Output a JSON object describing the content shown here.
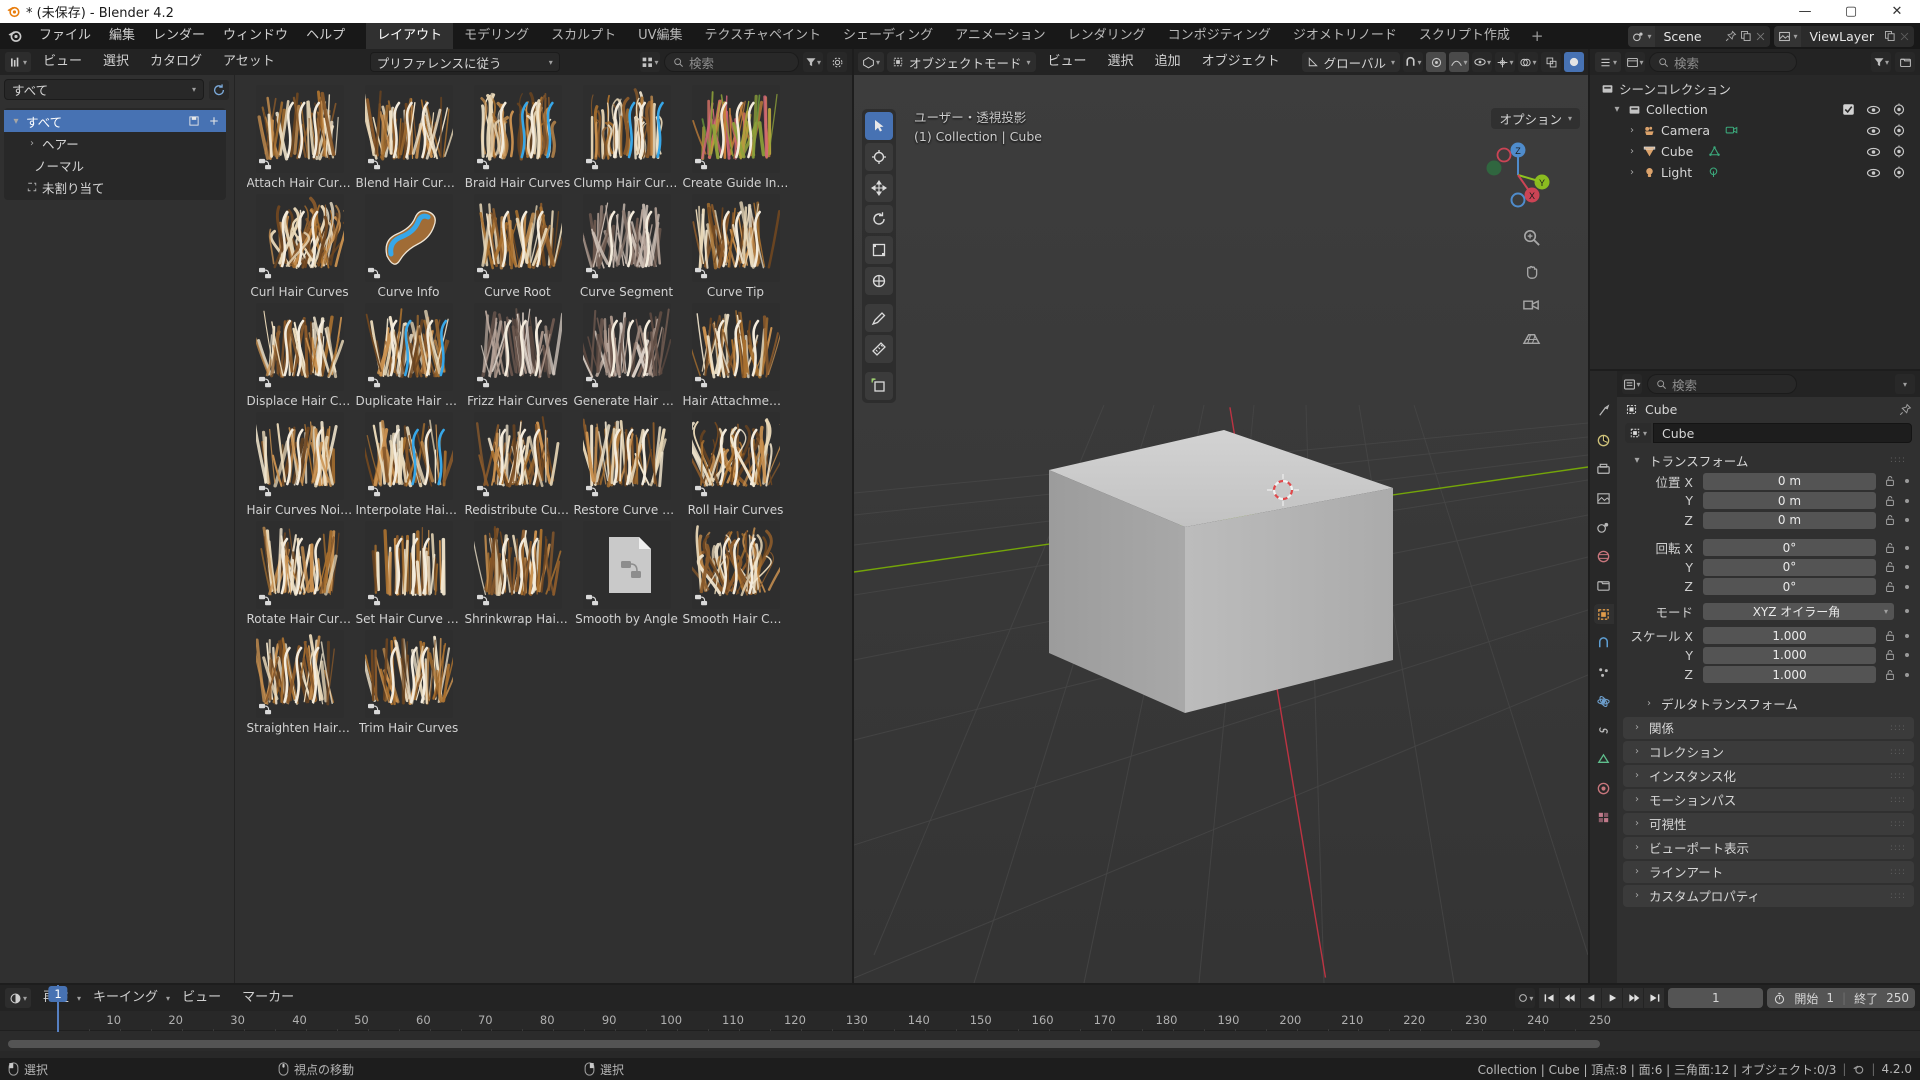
{
  "window": {
    "title": "* (未保存) - Blender 4.2",
    "buttons": {
      "minimize": "—",
      "maximize": "▢",
      "close": "✕"
    }
  },
  "topbar": {
    "menus": [
      "ファイル",
      "編集",
      "レンダー",
      "ウィンドウ",
      "ヘルプ"
    ],
    "workspaces": [
      "レイアウト",
      "モデリング",
      "スカルプト",
      "UV編集",
      "テクスチャペイント",
      "シェーディング",
      "アニメーション",
      "レンダリング",
      "コンポジティング",
      "ジオメトリノード",
      "スクリプト作成"
    ],
    "active_workspace": "レイアウト",
    "add_workspace": "+",
    "scene_name": "Scene",
    "viewlayer_name": "ViewLayer"
  },
  "asset_browser": {
    "editor_menus": [
      "ビュー",
      "選択",
      "カタログ",
      "アセット"
    ],
    "library": "プリファレンスに従う",
    "search_placeholder": "検索",
    "catalog_filter": "すべて",
    "catalog_tree": [
      {
        "label": "すべて",
        "selected": true,
        "level": 0
      },
      {
        "label": "ヘアー",
        "selected": false,
        "level": 1
      },
      {
        "label": "ノーマル",
        "selected": false,
        "level": 2
      },
      {
        "label": "未割り当て",
        "selected": false,
        "level": 1
      }
    ],
    "assets": [
      {
        "name": "Attach Hair Curv...",
        "thumb": "hair-brown-flat"
      },
      {
        "name": "Blend Hair Curves",
        "thumb": "hair-brown-wispy"
      },
      {
        "name": "Braid Hair Curves",
        "thumb": "hair-braid"
      },
      {
        "name": "Clump Hair Curves",
        "thumb": "hair-clump"
      },
      {
        "name": "Create Guide Ind...",
        "thumb": "hair-colored"
      },
      {
        "name": "Curl Hair Curves",
        "thumb": "hair-curl"
      },
      {
        "name": "Curve Info",
        "thumb": "curve-info"
      },
      {
        "name": "Curve Root",
        "thumb": "hair-root"
      },
      {
        "name": "Curve Segment",
        "thumb": "hair-segment"
      },
      {
        "name": "Curve Tip",
        "thumb": "hair-tip"
      },
      {
        "name": "Displace Hair Cur...",
        "thumb": "hair-displace"
      },
      {
        "name": "Duplicate Hair C...",
        "thumb": "hair-duplicate"
      },
      {
        "name": "Frizz Hair Curves",
        "thumb": "hair-frizz"
      },
      {
        "name": "Generate Hair Cu...",
        "thumb": "hair-generate"
      },
      {
        "name": "Hair Attachment ...",
        "thumb": "hair-attach"
      },
      {
        "name": "Hair Curves Noise",
        "thumb": "hair-noise"
      },
      {
        "name": "Interpolate Hair ...",
        "thumb": "hair-interpolate"
      },
      {
        "name": "Redistribute Cur...",
        "thumb": "hair-redistribute"
      },
      {
        "name": "Restore Curve Se...",
        "thumb": "hair-restore"
      },
      {
        "name": "Roll Hair Curves",
        "thumb": "hair-roll"
      },
      {
        "name": "Rotate Hair Curves",
        "thumb": "hair-rotate"
      },
      {
        "name": "Set Hair Curve Pr...",
        "thumb": "hair-profile"
      },
      {
        "name": "Shrinkwrap Hair ...",
        "thumb": "hair-shrinkwrap"
      },
      {
        "name": "Smooth by Angle",
        "thumb": "generic-node-doc"
      },
      {
        "name": "Smooth Hair Cur...",
        "thumb": "hair-smooth"
      },
      {
        "name": "Straighten Hair C...",
        "thumb": "hair-straighten"
      },
      {
        "name": "Trim Hair Curves",
        "thumb": "hair-trim"
      }
    ]
  },
  "viewport": {
    "mode": "オブジェクトモード",
    "menus": [
      "ビュー",
      "選択",
      "追加",
      "オブジェクト"
    ],
    "transform_orientation": "グローバル",
    "options_label": "オプション",
    "overlay_view": "ユーザー・透視投影",
    "overlay_scene": "(1) Collection | Cube",
    "gizmo_axes": [
      "X",
      "Y",
      "Z"
    ],
    "tools": [
      "select-box-tool",
      "cursor-tool",
      "move-tool",
      "rotate-tool",
      "scale-tool",
      "transform-tool",
      "annotate-tool",
      "measure-tool",
      "add-cube-tool"
    ]
  },
  "outliner": {
    "search_placeholder": "検索",
    "rows": [
      {
        "label": "シーンコレクション",
        "level": 0,
        "icon": "collection-icon",
        "has_disclosure": false,
        "checkbox": false,
        "eye": false,
        "camera": false
      },
      {
        "label": "Collection",
        "level": 1,
        "icon": "collection-icon",
        "has_disclosure": true,
        "expanded": true,
        "checkbox": true,
        "eye": true,
        "camera": true
      },
      {
        "label": "Camera",
        "level": 2,
        "icon": "camera-obj-icon",
        "datatype": "camera-data-icon",
        "has_disclosure": true,
        "expanded": false,
        "checkbox": false,
        "eye": true,
        "camera": true
      },
      {
        "label": "Cube",
        "level": 2,
        "icon": "mesh-obj-icon",
        "datatype": "mesh-data-icon",
        "has_disclosure": true,
        "expanded": false,
        "checkbox": false,
        "eye": true,
        "camera": true
      },
      {
        "label": "Light",
        "level": 2,
        "icon": "light-obj-icon",
        "datatype": "light-data-icon",
        "has_disclosure": true,
        "expanded": false,
        "checkbox": false,
        "eye": true,
        "camera": true
      }
    ]
  },
  "properties": {
    "search_placeholder": "検索",
    "breadcrumb": "Cube",
    "object_name": "Cube",
    "transform_panel": "トランスフォーム",
    "location_label": "位置 X",
    "rotation_label": "回転 X",
    "scale_label": "スケール X",
    "mode_label": "モード",
    "axis_y": "Y",
    "axis_z": "Z",
    "location": [
      "0 m",
      "0 m",
      "0 m"
    ],
    "rotation": [
      "0°",
      "0°",
      "0°"
    ],
    "rotation_mode": "XYZ オイラー角",
    "scale": [
      "1.000",
      "1.000",
      "1.000"
    ],
    "panels": [
      "デルタトランスフォーム",
      "関係",
      "コレクション",
      "インスタンス化",
      "モーションパス",
      "可視性",
      "ビューポート表示",
      "ラインアート",
      "カスタムプロパティ"
    ]
  },
  "timeline": {
    "menus": [
      "再生",
      "キーイング",
      "ビュー",
      "マーカー"
    ],
    "current_frame": "1",
    "start_label": "開始",
    "start_value": "1",
    "end_label": "終了",
    "end_value": "250",
    "ruler_ticks": [
      "1",
      "10",
      "20",
      "30",
      "40",
      "50",
      "60",
      "70",
      "80",
      "90",
      "100",
      "110",
      "120",
      "130",
      "140",
      "150",
      "160",
      "170",
      "180",
      "190",
      "200",
      "210",
      "220",
      "230",
      "240",
      "250"
    ],
    "playhead_frame": "1"
  },
  "statusbar": {
    "mouse_hints": [
      {
        "icon": "mouse-left-icon",
        "label": "選択"
      },
      {
        "icon": "mouse-middle-icon",
        "label": "視点の移動"
      },
      {
        "icon": "mouse-right-icon",
        "label": "選択"
      }
    ],
    "scene_stats": "Collection | Cube | 頂点:8 | 面:6 | 三角面:12 | オブジェクト:0/3",
    "version": "4.2.0"
  },
  "colors": {
    "accent_blue": "#4772b3",
    "header_dark": "#232323",
    "panel_bg": "#303030",
    "viewport_bg": "#393939",
    "axis_x_red": "#cc3344",
    "axis_y_green": "#7fb800"
  }
}
